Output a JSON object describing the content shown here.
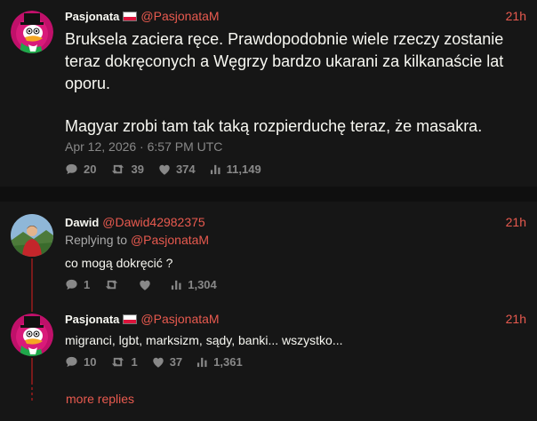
{
  "main_tweet": {
    "fullname": "Pasjonata",
    "username": "@PasjonataM",
    "time": "21h",
    "content_line1": "Bruksela zaciera ręce. Prawdopodobnie wiele rzeczy zostanie",
    "content_line2": "teraz dokręconych a Węgrzy bardzo ukarani za kilkanaście lat",
    "content_line3": "oporu.",
    "content_line4": "Magyar zrobi tam tak taką rozpierduchę teraz, że masakra.",
    "date": "Apr 12, 2026 · 6:57 PM UTC",
    "stats": {
      "replies": "20",
      "retweets": "39",
      "likes": "374",
      "views": "11,149"
    }
  },
  "reply1": {
    "fullname": "Dawid",
    "username": "@Dawid42982375",
    "time": "21h",
    "replying_prefix": "Replying to",
    "replying_to": "@PasjonataM",
    "content": "co mogą dokręcić ?",
    "stats": {
      "replies": "1",
      "retweets": "",
      "likes": "",
      "views": "1,304"
    }
  },
  "reply2": {
    "fullname": "Pasjonata",
    "username": "@PasjonataM",
    "time": "21h",
    "content": "migranci, lgbt, marksizm, sądy, banki... wszystko...",
    "stats": {
      "replies": "10",
      "retweets": "1",
      "likes": "37",
      "views": "1,361"
    }
  },
  "more_replies": "more replies",
  "colors": {
    "accent": "#e85a4f",
    "background": "#0f0f0f",
    "panel": "#161616",
    "thread_line": "#7a1a1a"
  }
}
